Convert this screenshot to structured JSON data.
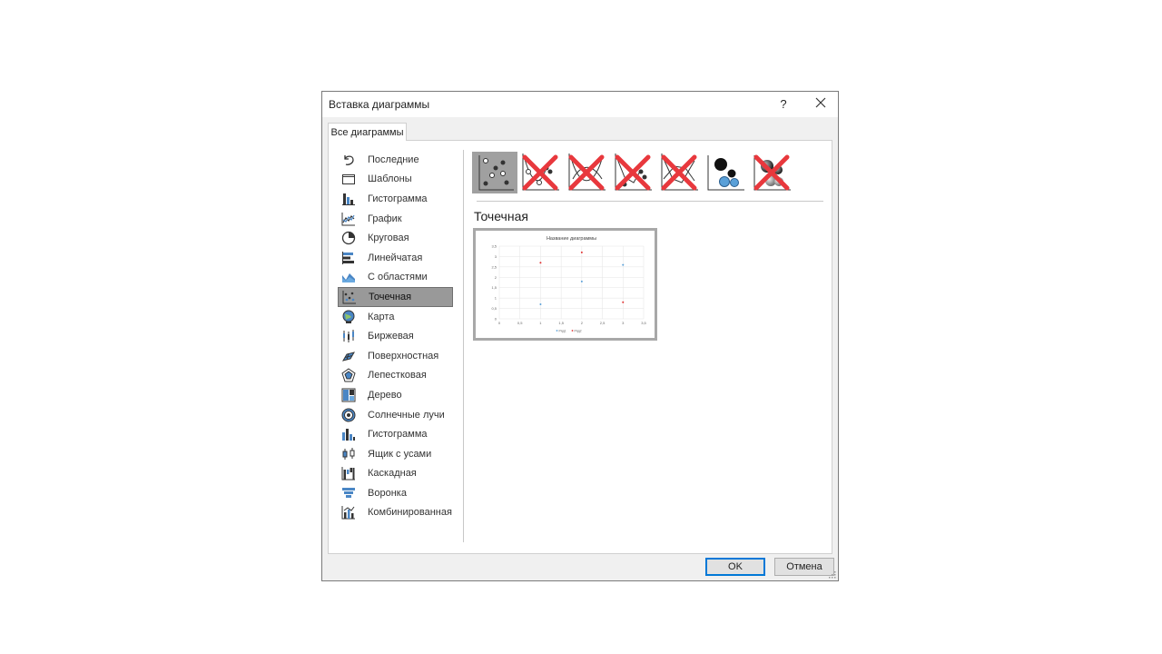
{
  "dialog": {
    "title": "Вставка диаграммы",
    "help": "?",
    "tab": "Все диаграммы",
    "section_title": "Точечная",
    "ok": "OK",
    "cancel": "Отмена"
  },
  "sidebar": {
    "items": [
      {
        "label": "Последние",
        "icon": "undo-icon"
      },
      {
        "label": "Шаблоны",
        "icon": "folder-icon"
      },
      {
        "label": "Гистограмма",
        "icon": "column-chart-icon"
      },
      {
        "label": "График",
        "icon": "line-chart-icon"
      },
      {
        "label": "Круговая",
        "icon": "pie-chart-icon"
      },
      {
        "label": "Линейчатая",
        "icon": "bar-chart-icon"
      },
      {
        "label": "С областями",
        "icon": "area-chart-icon"
      },
      {
        "label": "Точечная",
        "icon": "scatter-chart-icon",
        "selected": true
      },
      {
        "label": "Карта",
        "icon": "map-chart-icon"
      },
      {
        "label": "Биржевая",
        "icon": "stock-chart-icon"
      },
      {
        "label": "Поверхностная",
        "icon": "surface-chart-icon"
      },
      {
        "label": "Лепестковая",
        "icon": "radar-chart-icon"
      },
      {
        "label": "Дерево",
        "icon": "treemap-chart-icon"
      },
      {
        "label": "Солнечные лучи",
        "icon": "sunburst-chart-icon"
      },
      {
        "label": "Гистограмма",
        "icon": "histogram-chart-icon"
      },
      {
        "label": "Ящик с усами",
        "icon": "box-whisker-chart-icon"
      },
      {
        "label": "Каскадная",
        "icon": "waterfall-chart-icon"
      },
      {
        "label": "Воронка",
        "icon": "funnel-chart-icon"
      },
      {
        "label": "Комбинированная",
        "icon": "combo-chart-icon"
      }
    ]
  },
  "subtypes": [
    {
      "icon": "scatter-markers-icon",
      "selected": true,
      "crossed": false
    },
    {
      "icon": "scatter-smooth-lines-markers-icon",
      "crossed": true
    },
    {
      "icon": "scatter-smooth-lines-icon",
      "crossed": true
    },
    {
      "icon": "scatter-straight-lines-markers-icon",
      "crossed": true
    },
    {
      "icon": "scatter-straight-lines-icon",
      "crossed": true
    },
    {
      "icon": "bubble-icon",
      "crossed": false
    },
    {
      "icon": "bubble-3d-icon",
      "crossed": true
    }
  ],
  "colors": {
    "cross": "#e8383d",
    "series1": "#5aa0d8",
    "series2": "#e03030",
    "selected_bg": "#999999"
  },
  "chart_data": {
    "type": "scatter",
    "title": "Название диаграммы",
    "xlim": [
      0,
      3.5
    ],
    "ylim": [
      0,
      3.5
    ],
    "x_ticks": [
      "0",
      "0,5",
      "1",
      "1,5",
      "2",
      "2,5",
      "3",
      "3,5"
    ],
    "y_ticks": [
      "0",
      "0,5",
      "1",
      "1,5",
      "2",
      "2,5",
      "3",
      "3,5"
    ],
    "grid": true,
    "legend_position": "bottom",
    "series": [
      {
        "name": "Ряд1",
        "color": "#5aa0d8",
        "points": [
          [
            1,
            0.7
          ],
          [
            2,
            1.8
          ],
          [
            3,
            2.6
          ]
        ]
      },
      {
        "name": "Ряд2",
        "color": "#e03030",
        "points": [
          [
            1,
            2.7
          ],
          [
            2,
            3.2
          ],
          [
            3,
            0.8
          ]
        ]
      }
    ]
  }
}
